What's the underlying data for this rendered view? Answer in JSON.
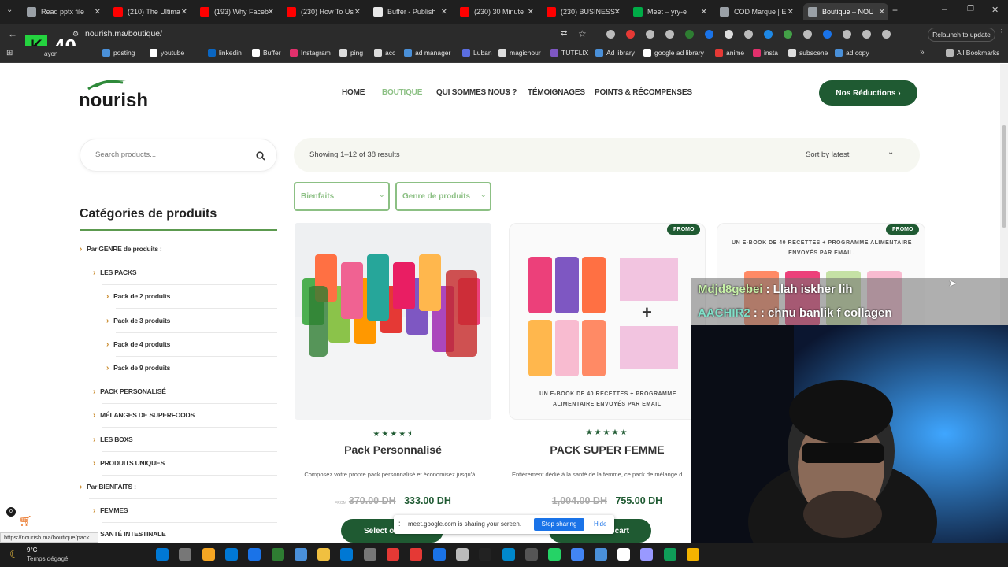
{
  "browser": {
    "tabs": [
      {
        "label": "Read pptx file",
        "color": "#9aa0a6"
      },
      {
        "label": "(210) The Ultima",
        "color": "#ff0000"
      },
      {
        "label": "(193) Why Faceb",
        "color": "#ff0000"
      },
      {
        "label": "(230) How To Us",
        "color": "#ff0000"
      },
      {
        "label": "Buffer - Publish",
        "color": "#e8e8e8"
      },
      {
        "label": "(230) 30 Minute",
        "color": "#ff0000"
      },
      {
        "label": "(230) BUSINESS",
        "color": "#ff0000"
      },
      {
        "label": "Meet – yry-e",
        "color": "#00ac47"
      },
      {
        "label": "COD Marque | E",
        "color": "#9aa0a6"
      },
      {
        "label": "Boutique – NOU",
        "color": "#9aa0a6"
      }
    ],
    "url": "nourish.ma/boutique/",
    "relaunch": "Relaunch to update",
    "bookmarks": [
      {
        "label": "posting",
        "color": "#4a90d9"
      },
      {
        "label": "youtube",
        "color": "#ffffff"
      },
      {
        "label": "linkedin",
        "color": "#0a66c2"
      },
      {
        "label": "Buffer",
        "color": "#ffffff"
      },
      {
        "label": "Instagram",
        "color": "#e1306c"
      },
      {
        "label": "ping",
        "color": "#dddddd"
      },
      {
        "label": "acc",
        "color": "#dddddd"
      },
      {
        "label": "ad manager",
        "color": "#4a90d9"
      },
      {
        "label": "Luban",
        "color": "#5b6ee1"
      },
      {
        "label": "magichour",
        "color": "#dddddd"
      },
      {
        "label": "TUTFLIX",
        "color": "#7e57c2"
      },
      {
        "label": "Ad library",
        "color": "#4a90d9"
      },
      {
        "label": "google ad library",
        "color": "#ffffff"
      },
      {
        "label": "anime",
        "color": "#e53935"
      },
      {
        "label": "insta",
        "color": "#e1306c"
      },
      {
        "label": "subscene",
        "color": "#dddddd"
      },
      {
        "label": "ad copy",
        "color": "#4a90d9"
      }
    ],
    "all_bookmarks": "All Bookmarks",
    "overlay_count": "40",
    "overlay_prefix": "ayon"
  },
  "site": {
    "logo": "nourish",
    "nav": [
      "HOME",
      "BOUTIQUE",
      "QUI SOMMES NOUS ?",
      "TÉMOIGNAGES",
      "POINTS & RÉCOMPENSES"
    ],
    "cta": "Nos Réductions ›",
    "search_placeholder": "Search products...",
    "showing": "Showing 1–12 of 38 results",
    "sort": "Sort by latest",
    "filters": [
      "Bienfaits",
      "Genre de produits"
    ],
    "categories_title": "Catégories de produits",
    "categories": [
      {
        "label": "Par GENRE de produits :",
        "level": 0
      },
      {
        "label": "LES PACKS",
        "level": 1
      },
      {
        "label": "Pack de 2 produits",
        "level": 2
      },
      {
        "label": "Pack de 3 produits",
        "level": 2
      },
      {
        "label": "Pack de 4 produits",
        "level": 2
      },
      {
        "label": "Pack de 9 produits",
        "level": 2
      },
      {
        "label": "PACK PERSONALISÉ",
        "level": 1
      },
      {
        "label": "MÉLANGES DE SUPERFOODS",
        "level": 1
      },
      {
        "label": "LES BOXS",
        "level": 1
      },
      {
        "label": "PRODUITS UNIQUES",
        "level": 1
      },
      {
        "label": "Par BIENFAITS :",
        "level": 0
      },
      {
        "label": "FEMMES",
        "level": 1
      },
      {
        "label": "SANTÉ INTESTINALE",
        "level": 1
      }
    ],
    "products": [
      {
        "title": "Pack Personnalisé",
        "desc": "Composez votre propre pack personnalisé et économisez jusqu'à ...",
        "from": "FROM",
        "old": "370.00 DH",
        "new": "333.00 DH",
        "button": "Select o",
        "rating": 4.5
      },
      {
        "title": "PACK SUPER FEMME",
        "desc": "Entièrement dédié à la santé de la femme, ce pack de mélange d",
        "old": "1,004.00 DH",
        "new": "755.00 DH",
        "button": "cart",
        "promo": "PROMO",
        "banner": "UN E-BOOK DE 40 RECETTES + PROGRAMME ALIMENTAIRE ENVOYÉS PAR EMAIL.",
        "rating": 5
      },
      {
        "promo": "PROMO",
        "banner": "UN E-BOOK DE 40 RECETTES + PROGRAMME ALIMENTAIRE ENVOYÉS PAR EMAIL."
      }
    ],
    "cart_count": "0",
    "status_url": "https://nourish.ma/boutique/pack..."
  },
  "chat": [
    {
      "user": "Mdjd8gebei",
      "text": ": Llah iskher lih",
      "color": "#c7f0a8"
    },
    {
      "user": "AACHIR2",
      "text": ": : chnu banlik f collagen",
      "color": "#7fe0c8"
    }
  ],
  "meet_bar": {
    "text": "meet.google.com is sharing your screen.",
    "stop": "Stop sharing",
    "hide": "Hide"
  },
  "taskbar": {
    "temp": "9°C",
    "weather": "Temps dégagé"
  }
}
